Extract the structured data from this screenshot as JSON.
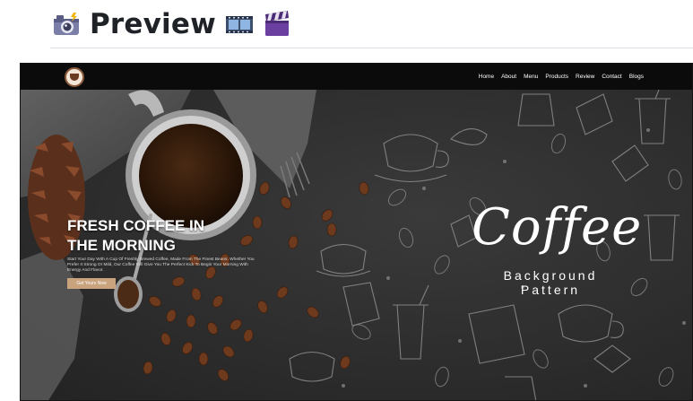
{
  "heading": {
    "title": "Preview",
    "icons": [
      "camera-with-flash-icon",
      "film-frames-icon",
      "clapper-board-icon"
    ]
  },
  "site": {
    "nav": [
      "Home",
      "About",
      "Menu",
      "Products",
      "Review",
      "Contact",
      "Blogs"
    ],
    "hero": {
      "title_line1": "FRESH COFFEE IN",
      "title_line2": "THE MORNING",
      "description": "Start Your Day With A Cup Of Freshly Brewed Coffee, Made From The Finest Beans. Whether You Prefer It Strong Or Mild, Our Coffee Will Give You The Perfect Kick To Begin Your Morning With Energy And Flavor.",
      "button": "Get Yours Now"
    },
    "graphic": {
      "script": "Coffee",
      "line1": "Background",
      "line2": "Pattern"
    }
  },
  "colors": {
    "accent": "#c9a27e",
    "navbar": "#0b0b0b",
    "board": "#2d2d2d"
  }
}
